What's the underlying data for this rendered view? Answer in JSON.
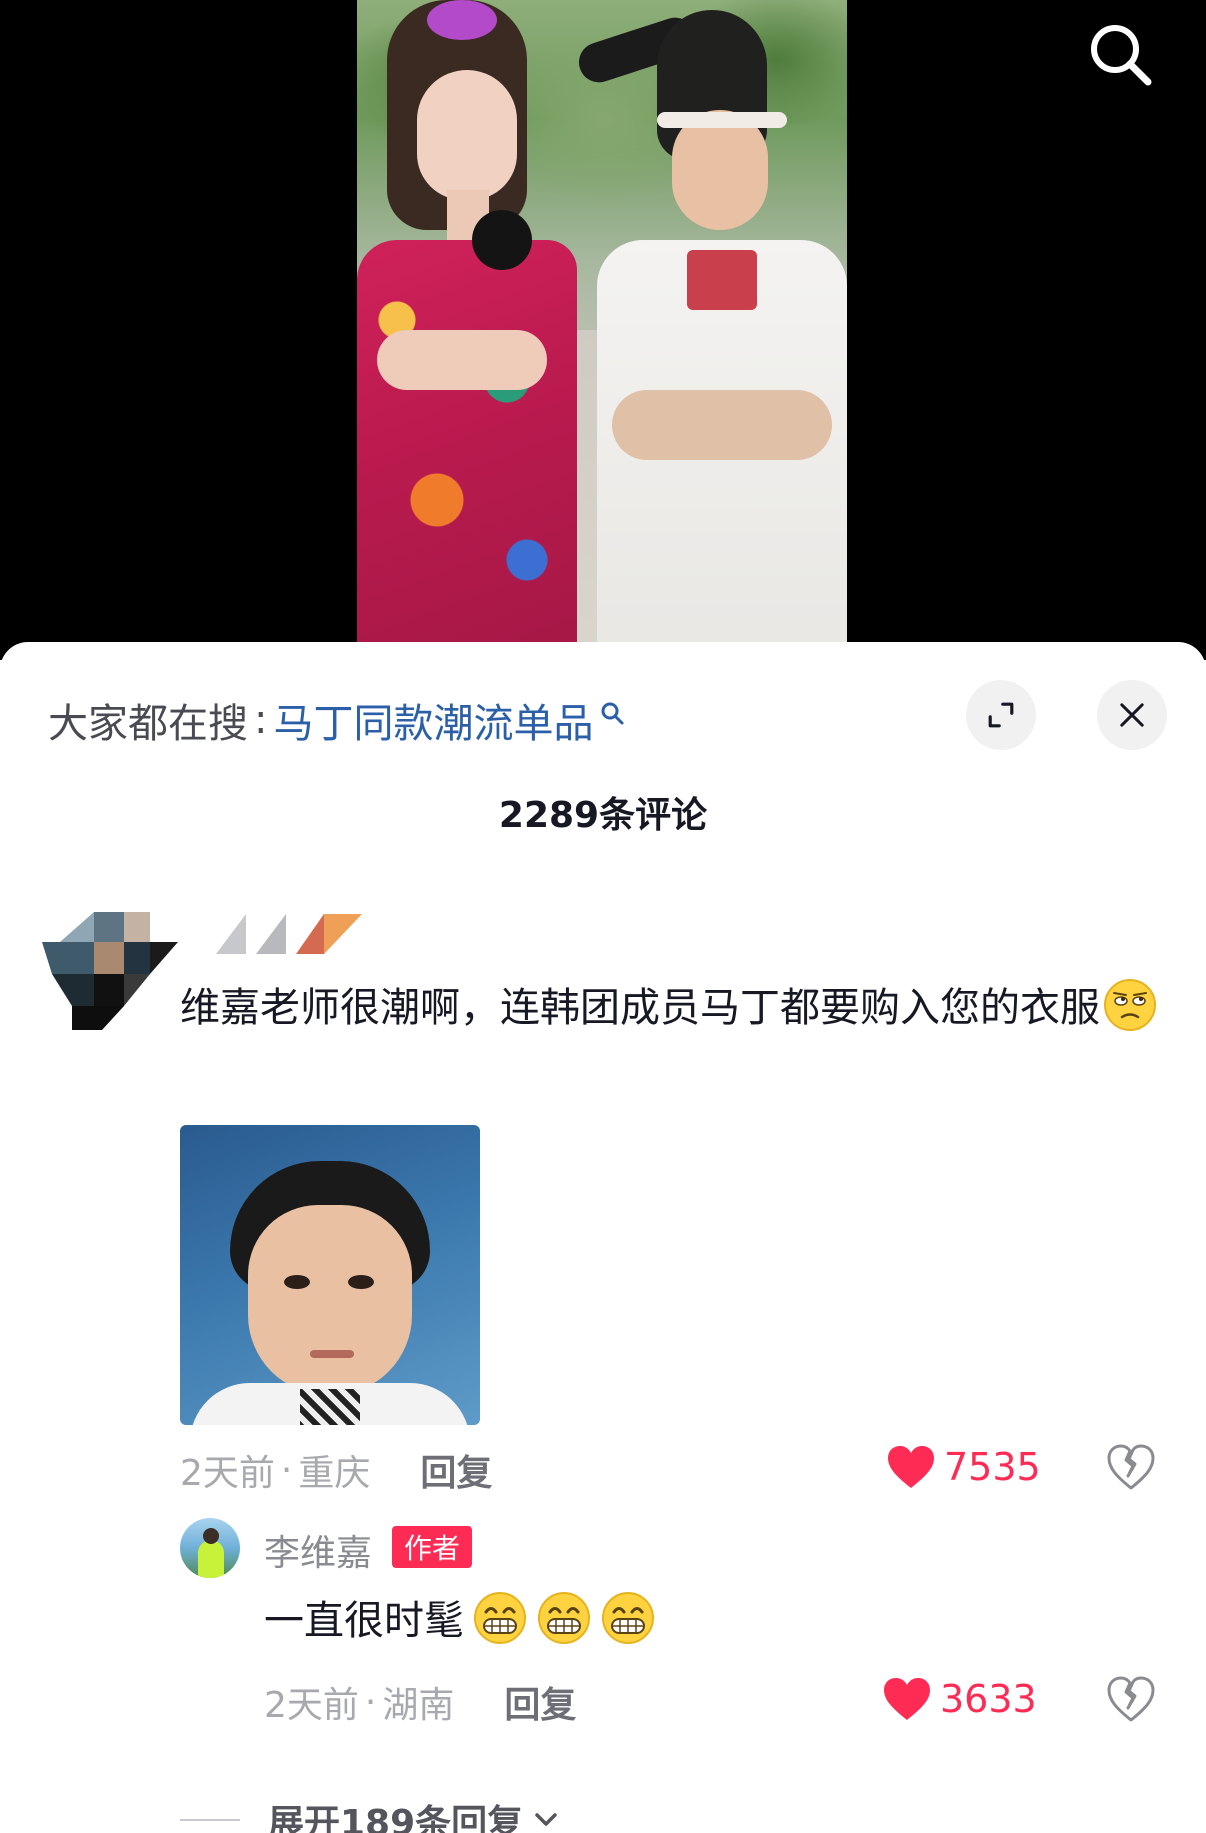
{
  "video": {
    "search_icon": "search-icon"
  },
  "sheet": {
    "search_bar": {
      "prefix": "大家都在搜",
      "separator": ":",
      "term": "马丁同款潮流单品",
      "term_color": "#2b5fa8",
      "term_icon": "search-icon"
    },
    "buttons": {
      "expand_icon": "expand-icon",
      "close_icon": "close-icon"
    },
    "comment_count": "2289条评论",
    "comments": [
      {
        "text": "维嘉老师很潮啊，连韩团成员马丁都要购入您的衣服",
        "emoji": "eye-roll-emoji",
        "time": "2天前",
        "location": "重庆",
        "meta_separator": "·",
        "reply_label": "回复",
        "likes": "7535",
        "like_icon": "heart-icon",
        "dislike_icon": "broken-heart-icon",
        "like_color": "#fe2c55"
      }
    ],
    "reply": {
      "username": "李维嘉",
      "badge": "作者",
      "badge_color": "#fe2c55",
      "text": "一直很时髦",
      "emojis": [
        "grin-emoji",
        "grin-emoji",
        "grin-emoji"
      ],
      "time": "2天前",
      "location": "湖南",
      "meta_separator": "·",
      "reply_label": "回复",
      "likes": "3633",
      "like_icon": "heart-icon",
      "dislike_icon": "broken-heart-icon"
    },
    "expand_replies": {
      "label": "展开189条回复",
      "icon": "chevron-down-icon"
    }
  }
}
